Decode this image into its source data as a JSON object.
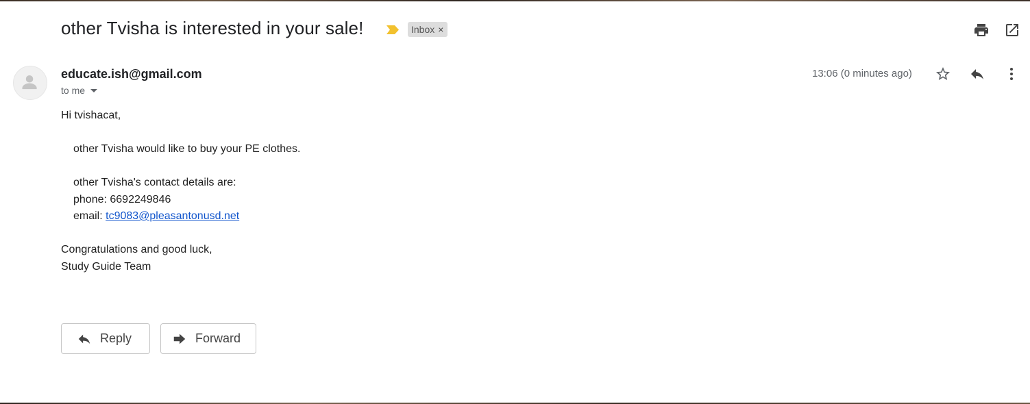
{
  "email": {
    "subject": "other Tvisha is interested in your sale!",
    "label_chip": "Inbox",
    "label_chip_close": "×",
    "sender": "educate.ish@gmail.com",
    "recipient": "to me",
    "timestamp": "13:06 (0 minutes ago)",
    "body": {
      "greeting": "Hi tvishacat,",
      "message": "other Tvisha would like to buy your PE clothes.",
      "contact_intro": "other Tvisha's contact details are:",
      "phone": "phone: 6692249846",
      "email_prefix": "email: ",
      "email_link": "tc9083@pleasantonusd.net",
      "closing": "Congratulations and good luck,",
      "signature": "Study Guide Team"
    }
  },
  "actions": {
    "reply_label": "Reply",
    "forward_label": "Forward"
  },
  "icons": {
    "importance": "importance-marker-icon",
    "print": "print-icon",
    "new_window": "open-in-new-window-icon",
    "star": "star-icon",
    "reply": "reply-icon",
    "more": "more-vertical-icon",
    "avatar": "person-icon",
    "forward": "forward-icon"
  },
  "colors": {
    "importance_marker": "#f2c12e",
    "link": "#1155cc",
    "chip_background": "#dddddd"
  }
}
